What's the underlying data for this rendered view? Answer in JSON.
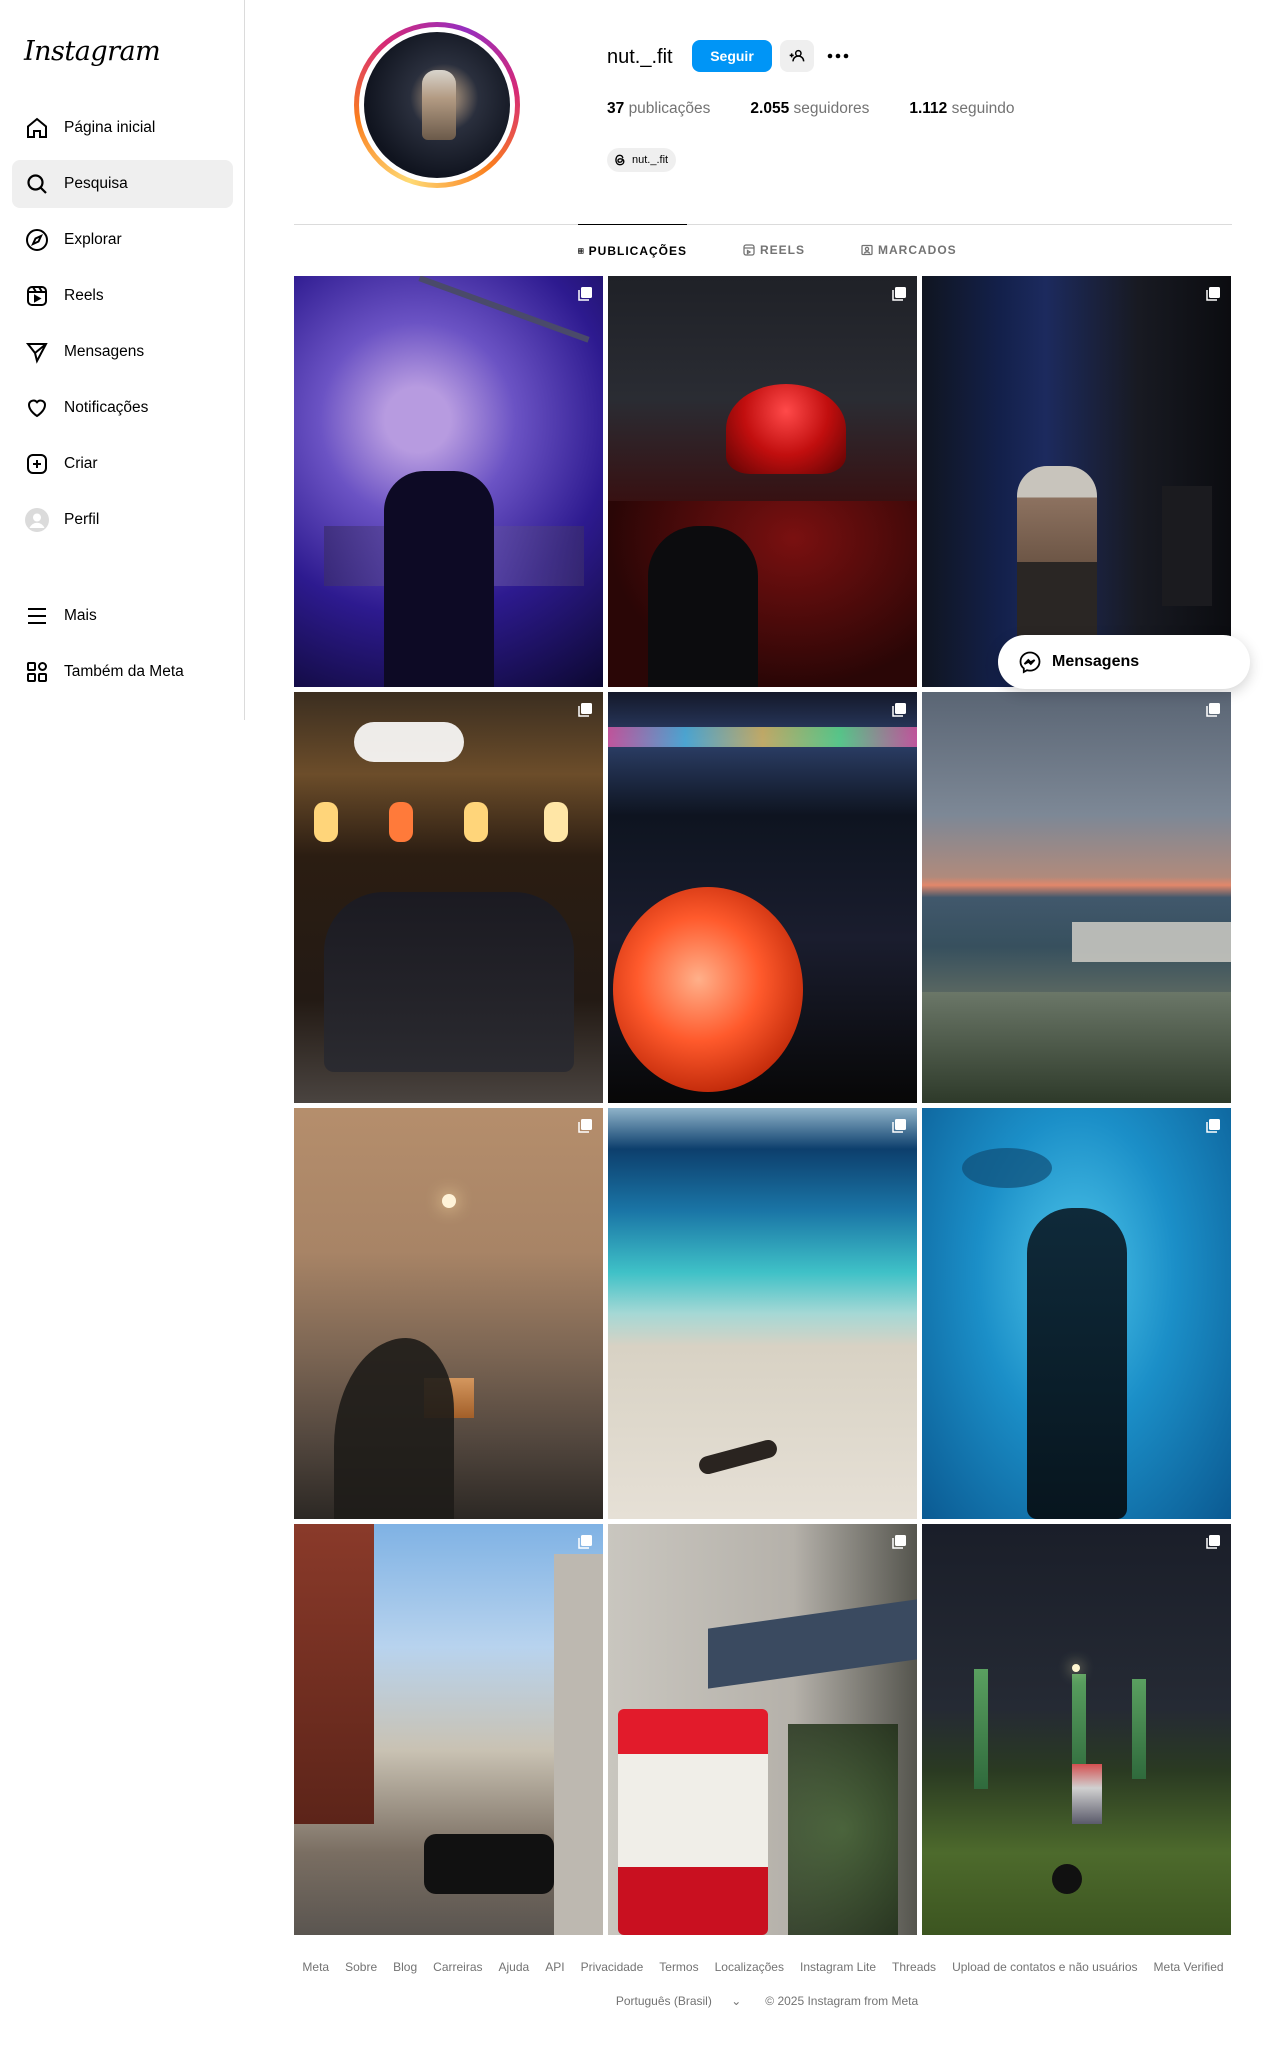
{
  "sidebar": {
    "logo": "Instagram",
    "items": [
      {
        "label": "Página inicial",
        "icon": "home-icon"
      },
      {
        "label": "Pesquisa",
        "icon": "search-icon"
      },
      {
        "label": "Explorar",
        "icon": "compass-icon"
      },
      {
        "label": "Reels",
        "icon": "reels-icon"
      },
      {
        "label": "Mensagens",
        "icon": "send-icon"
      },
      {
        "label": "Notificações",
        "icon": "heart-icon"
      },
      {
        "label": "Criar",
        "icon": "plus-icon"
      },
      {
        "label": "Perfil",
        "icon": "avatar-icon"
      },
      {
        "label": "Mais",
        "icon": "menu-icon"
      },
      {
        "label": "Também da Meta",
        "icon": "grid-icon"
      }
    ]
  },
  "profile": {
    "username": "nut._.fit",
    "follow_label": "Seguir",
    "stats": [
      {
        "value": "37",
        "label": "publicações"
      },
      {
        "value": "2.055",
        "label": "seguidores"
      },
      {
        "value": "1.112",
        "label": "seguindo"
      }
    ],
    "threads_handle": "nut._.fit"
  },
  "tabs": [
    {
      "label": "PUBLICAÇÕES"
    },
    {
      "label": "REELS"
    },
    {
      "label": "MARCADOS"
    }
  ],
  "messages_label": "Mensagens",
  "footer": {
    "links": [
      "Meta",
      "Sobre",
      "Blog",
      "Carreiras",
      "Ajuda",
      "API",
      "Privacidade",
      "Termos",
      "Localizações",
      "Instagram Lite",
      "Threads",
      "Upload de contatos e não usuários",
      "Meta Verified"
    ],
    "language": "Português (Brasil)",
    "copyright": "© 2025 Instagram from Meta"
  },
  "colors": {
    "accent": "#0095f6",
    "muted": "#737373"
  }
}
